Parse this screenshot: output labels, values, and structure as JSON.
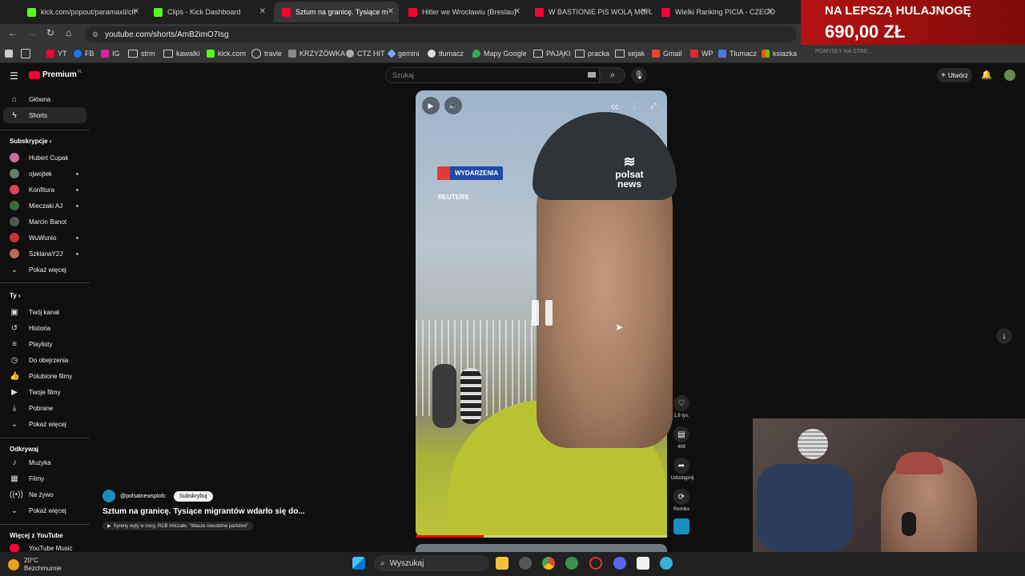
{
  "browser": {
    "tabs": [
      {
        "title": "kick.com/popout/paramaxil/ch",
        "color": "#53fc18"
      },
      {
        "title": "Clips - Kick Dashboard",
        "color": "#53fc18"
      },
      {
        "title": "Sztum na granicę. Tysiące m",
        "color": "#ff0033",
        "active": true
      },
      {
        "title": "Hitler we Wrocławiu (Breslau)",
        "color": "#ff0033"
      },
      {
        "title": "W BASTIONIE PiS WOLĄ MORA",
        "color": "#ff0033"
      },
      {
        "title": "Wielki Ranking PICIA - CZEGO",
        "color": "#ff0033"
      }
    ],
    "address": "youtube.com/shorts/AmB2imO7Isg",
    "bookmarks": [
      "YT",
      "FB",
      "IG",
      "strm",
      "kawalki",
      "kick.com",
      "travle",
      "KRZYŻÓWKA",
      "CTZ HIT",
      "gemini",
      "tłumacz",
      "Mapy Google",
      "PAJĄKI",
      "pracka",
      "sejak",
      "Gmail",
      "WP",
      "Tłumacz",
      "ksiazka"
    ]
  },
  "overlay": {
    "line1": "NA LEPSZĄ HULAJNOGĘ",
    "line2": "690,00 ZŁ",
    "ticker": "POMYSŁY NA STRE..."
  },
  "youtube": {
    "logo": "Premium",
    "logo_badge": "PL",
    "search_placeholder": "Szukaj",
    "create_label": "Utwórz",
    "sidebar": {
      "main": [
        {
          "label": "Główna",
          "icon": "home-icon"
        },
        {
          "label": "Shorts",
          "icon": "shorts-icon",
          "active": true
        }
      ],
      "subs_header": "Subskrypcje",
      "subs": [
        {
          "label": "Hubert Cupak",
          "color": "#c86e9a"
        },
        {
          "label": "ojwojtek",
          "color": "#5f7f6a"
        },
        {
          "label": "Konfitura",
          "color": "#d9425a"
        },
        {
          "label": "Mieczaki AJ",
          "color": "#3b6b3d"
        },
        {
          "label": "Marcin Banot",
          "color": "#555555"
        },
        {
          "label": "WuWunio",
          "color": "#c8303a"
        },
        {
          "label": "SzklanaY2J",
          "color": "#b86a4a"
        }
      ],
      "show_more": "Pokaż więcej",
      "you_header": "Ty",
      "you": [
        {
          "label": "Twój kanał",
          "icon": "channel-icon"
        },
        {
          "label": "Historia",
          "icon": "history-icon"
        },
        {
          "label": "Playlisty",
          "icon": "playlist-icon"
        },
        {
          "label": "Do obejrzenia",
          "icon": "watch-later-icon"
        },
        {
          "label": "Polubione filmy",
          "icon": "like-icon"
        },
        {
          "label": "Twoje filmy",
          "icon": "video-icon"
        },
        {
          "label": "Pobrane",
          "icon": "download-icon"
        },
        {
          "label": "Pokaż więcej",
          "icon": "chevron-down-icon"
        }
      ],
      "explore_header": "Odkrywaj",
      "explore": [
        {
          "label": "Muzyka",
          "icon": "music-icon"
        },
        {
          "label": "Filmy",
          "icon": "film-icon"
        },
        {
          "label": "Na żywo",
          "icon": "live-icon"
        },
        {
          "label": "Pokaż więcej",
          "icon": "chevron-down-icon"
        }
      ],
      "more_header": "Więcej z YouTube",
      "more_first": "YouTube Music"
    },
    "video": {
      "badge": "WYDARZENIA",
      "reuters": "REUTERS",
      "polsat_line1": "polsat",
      "polsat_line2": "news",
      "progress": 0.27,
      "channel": "@polsatnewsplofc",
      "subscribe": "Subskrybuj",
      "title": "Sztum na granicę. Tysiące migrantów wdarło się do...",
      "subtitle": "Syreny wyły w nocy, RCB milczało. \"Wasze nieudolne państwo\""
    },
    "actions": [
      {
        "label": "1,8 tys.",
        "icon": "like-icon"
      },
      {
        "label": "469",
        "icon": "comment-icon"
      },
      {
        "label": "Udostępnij",
        "icon": "share-icon"
      },
      {
        "label": "Remiks",
        "icon": "remix-icon"
      }
    ]
  },
  "taskbar": {
    "temp": "20°C",
    "weather": "Bezchmurnie",
    "search": "Wyszukaj"
  }
}
